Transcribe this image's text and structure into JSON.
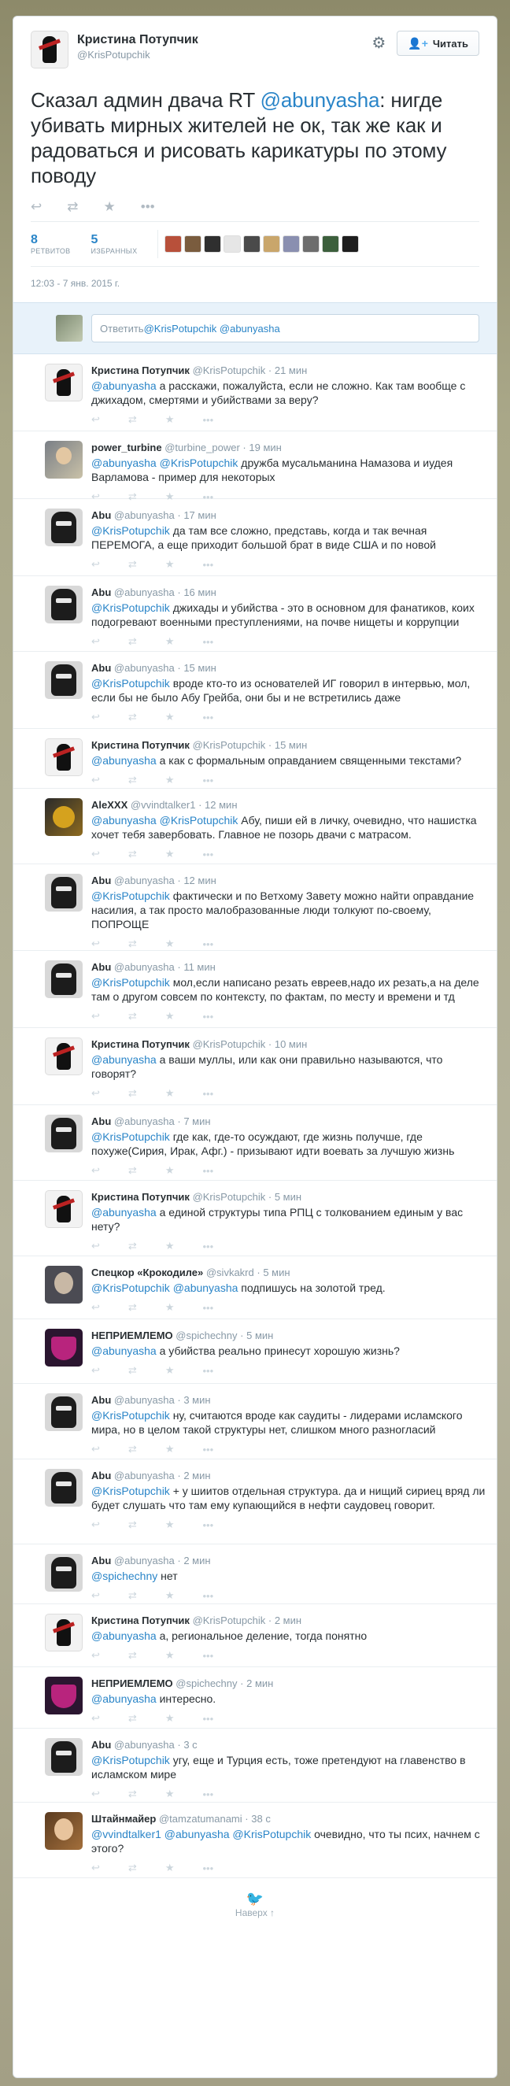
{
  "tweet": {
    "author_name": "Кристина Потупчик",
    "author_handle": "@KrisPotupchik",
    "follow_label": "Читать",
    "text_pre": "Сказал админ двача RT ",
    "text_mention": "@abunyasha",
    "text_post": ": нигде убивать мирных жителей не ок, так же как и радоваться и рисовать карикатуры по этому поводу",
    "retweets_count": "8",
    "retweets_label": "РЕТВИТОВ",
    "favorites_count": "5",
    "favorites_label": "ИЗБРАННЫХ",
    "timestamp": "12:03 - 7 янв. 2015 г."
  },
  "reply_box": {
    "prefix": "Ответить ",
    "mention1": "@KrisPotupchik",
    "mention2": "@abunyasha"
  },
  "fav_colors": [
    "#b8503a",
    "#7a5c3e",
    "#2f2f2f",
    "#e6e6e6",
    "#4a4a4a",
    "#c9a66b",
    "#8a8fb0",
    "#6d6d6d",
    "#3c5f3c",
    "#1e1e1e"
  ],
  "replies": [
    {
      "name": "Кристина Потупчик",
      "handle": "@KrisPotupchik",
      "time": "21 мин",
      "avatar": "kris",
      "mentions": "@abunyasha",
      "text": " а расскажи, пожалуйста, если не сложно. Как там вообще с джихадом, смертями и убийствами за веру?"
    },
    {
      "name": "power_turbine",
      "handle": "@turbine_power",
      "time": "19 мин",
      "avatar": "power",
      "mentions": "@abunyasha @KrisPotupchik",
      "text": " дружба мусальманина Намазова и иудея Варламова - пример для некоторых"
    },
    {
      "name": "Abu",
      "handle": "@abunyasha",
      "time": "17 мин",
      "avatar": "abu",
      "mentions": "@KrisPotupchik",
      "text": " да там все сложно, представь, когда и так вечная ПЕРЕМОГА, а еще приходит большой брат в виде США и по новой"
    },
    {
      "name": "Abu",
      "handle": "@abunyasha",
      "time": "16 мин",
      "avatar": "abu",
      "mentions": "@KrisPotupchik",
      "text": " джихады и убийства - это в основном для фанатиков, коих подогревают военными преступлениями, на почве нищеты и коррупции"
    },
    {
      "name": "Abu",
      "handle": "@abunyasha",
      "time": "15 мин",
      "avatar": "abu",
      "mentions": "@KrisPotupchik",
      "text": " вроде кто-то из основателей ИГ говорил в интервью, мол, если бы не было Абу Грейба, они бы и не встретились даже"
    },
    {
      "name": "Кристина Потупчик",
      "handle": "@KrisPotupchik",
      "time": "15 мин",
      "avatar": "kris",
      "mentions": "@abunyasha",
      "text": " а как с формальным оправданием священными текстами?"
    },
    {
      "name": "AleXXX",
      "handle": "@vvindtalker1",
      "time": "12 мин",
      "avatar": "alex",
      "mentions": "@abunyasha @KrisPotupchik",
      "text": " Абу, пиши ей в личку, очевидно, что нашистка хочет тебя завербовать. Главное не позорь двачи с матрасом."
    },
    {
      "name": "Abu",
      "handle": "@abunyasha",
      "time": "12 мин",
      "avatar": "abu",
      "mentions": "@KrisPotupchik",
      "text": " фактически и по Ветхому Завету можно найти оправдание насилия, а так просто малобразованные люди толкуют по-своему, ПОПРОЩЕ"
    },
    {
      "name": "Abu",
      "handle": "@abunyasha",
      "time": "11 мин",
      "avatar": "abu",
      "mentions": "@KrisPotupchik",
      "text": " мол,если написано резать евреев,надо их резать,а на деле там о другом совсем по контексту, по фактам, по месту и времени и тд"
    },
    {
      "name": "Кристина Потупчик",
      "handle": "@KrisPotupchik",
      "time": "10 мин",
      "avatar": "kris",
      "mentions": "@abunyasha",
      "text": " а ваши муллы, или как они правильно называются, что говорят?"
    },
    {
      "name": "Abu",
      "handle": "@abunyasha",
      "time": "7 мин",
      "avatar": "abu",
      "mentions": "@KrisPotupchik",
      "text": " где как, где-то осуждают, где жизнь получше, где похуже(Сирия, Ирак, Афг.) - призывают идти воевать за лучшую жизнь"
    },
    {
      "name": "Кристина Потупчик",
      "handle": "@KrisPotupchik",
      "time": "5 мин",
      "avatar": "kris",
      "mentions": "@abunyasha",
      "text": " а единой структуры типа РПЦ с толкованием единым у вас нету?"
    },
    {
      "name": "Спецкор «Крокодиле»",
      "handle": "@sivkakrd",
      "time": "5 мин",
      "avatar": "spec",
      "mentions": "@KrisPotupchik @abunyasha",
      "text": " подпишусь на золотой тред."
    },
    {
      "name": "НЕПРИЕМЛЕМО",
      "handle": "@spichechny",
      "time": "5 мин",
      "avatar": "nepr",
      "mentions": "@abunyasha",
      "text": " а убийства реально принесут хорошую жизнь?"
    },
    {
      "name": "Abu",
      "handle": "@abunyasha",
      "time": "3 мин",
      "avatar": "abu",
      "mentions": "@KrisPotupchik",
      "text": " ну, считаются вроде как саудиты - лидерами исламского мира, но в целом такой структуры нет, слишком много разногласий"
    },
    {
      "name": "Abu",
      "handle": "@abunyasha",
      "time": "2 мин",
      "avatar": "abu",
      "mentions": "@KrisPotupchik",
      "text": " + у шиитов отдельная структура. да и нищий сириец вряд ли будет слушать что там ему купающийся в нефти саудовец говорит."
    },
    {
      "name": "Abu",
      "handle": "@abunyasha",
      "time": "2 мин",
      "avatar": "abu",
      "mentions": "@spichechny",
      "text": " нет"
    },
    {
      "name": "Кристина Потупчик",
      "handle": "@KrisPotupchik",
      "time": "2 мин",
      "avatar": "kris",
      "mentions": "@abunyasha",
      "text": " а, региональное деление, тогда понятно"
    },
    {
      "name": "НЕПРИЕМЛЕМО",
      "handle": "@spichechny",
      "time": "2 мин",
      "avatar": "nepr",
      "mentions": "@abunyasha",
      "text": " интересно."
    },
    {
      "name": "Abu",
      "handle": "@abunyasha",
      "time": "3 с",
      "avatar": "abu",
      "mentions": "@KrisPotupchik",
      "text": " угу, еще и Турция есть, тоже претендуют на главенство в исламском мире"
    },
    {
      "name": "Штайнмайер",
      "handle": "@tamzatumanami",
      "time": "38 с",
      "avatar": "shtai",
      "mentions": "@vvindtalker1 @abunyasha @KrisPotupchik",
      "text": " очевидно, что ты псих, начнем с этого?"
    }
  ],
  "footer": {
    "back_to_top": "Наверх ↑"
  }
}
